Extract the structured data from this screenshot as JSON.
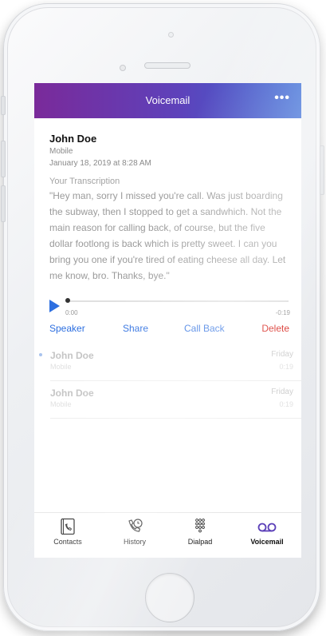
{
  "header": {
    "title": "Voicemail",
    "more_icon": "more-dots-icon",
    "gradient": [
      "#7a2a9a",
      "#3a6cd6"
    ]
  },
  "detail": {
    "name": "John Doe",
    "type": "Mobile",
    "datetime": "January 18, 2019 at 8:28 AM",
    "transcription_label": "Your Transcription",
    "transcription": "\"Hey man, sorry I missed you're call. Was just boarding the subway, then I stopped to get a sandwhich. Not the main reason for calling back, of course, but the five dollar footlong is back which is pretty sweet. I can you bring you one if you're tired of eating cheese all day. Let me know, bro. Thanks, bye.\""
  },
  "player": {
    "elapsed": "0:00",
    "remaining": "-0:19",
    "progress": 0.0,
    "accent": "#2d6fe0"
  },
  "actions": {
    "speaker": "Speaker",
    "share": "Share",
    "call_back": "Call Back",
    "delete": "Delete",
    "link_color": "#2d6fe0",
    "delete_color": "#d9322b"
  },
  "voicemails": [
    {
      "name": "John Doe",
      "type": "Mobile",
      "day": "Friday",
      "duration": "0:19",
      "unread": true
    },
    {
      "name": "John Doe",
      "type": "Mobile",
      "day": "Friday",
      "duration": "0:19",
      "unread": false
    }
  ],
  "tabs": [
    {
      "label": "Contacts",
      "icon": "contacts-book-icon"
    },
    {
      "label": "History",
      "icon": "phone-clock-icon"
    },
    {
      "label": "Dialpad",
      "icon": "dialpad-icon"
    },
    {
      "label": "Voicemail",
      "icon": "voicemail-icon",
      "active": true,
      "active_color": "#5b3fb8"
    }
  ]
}
